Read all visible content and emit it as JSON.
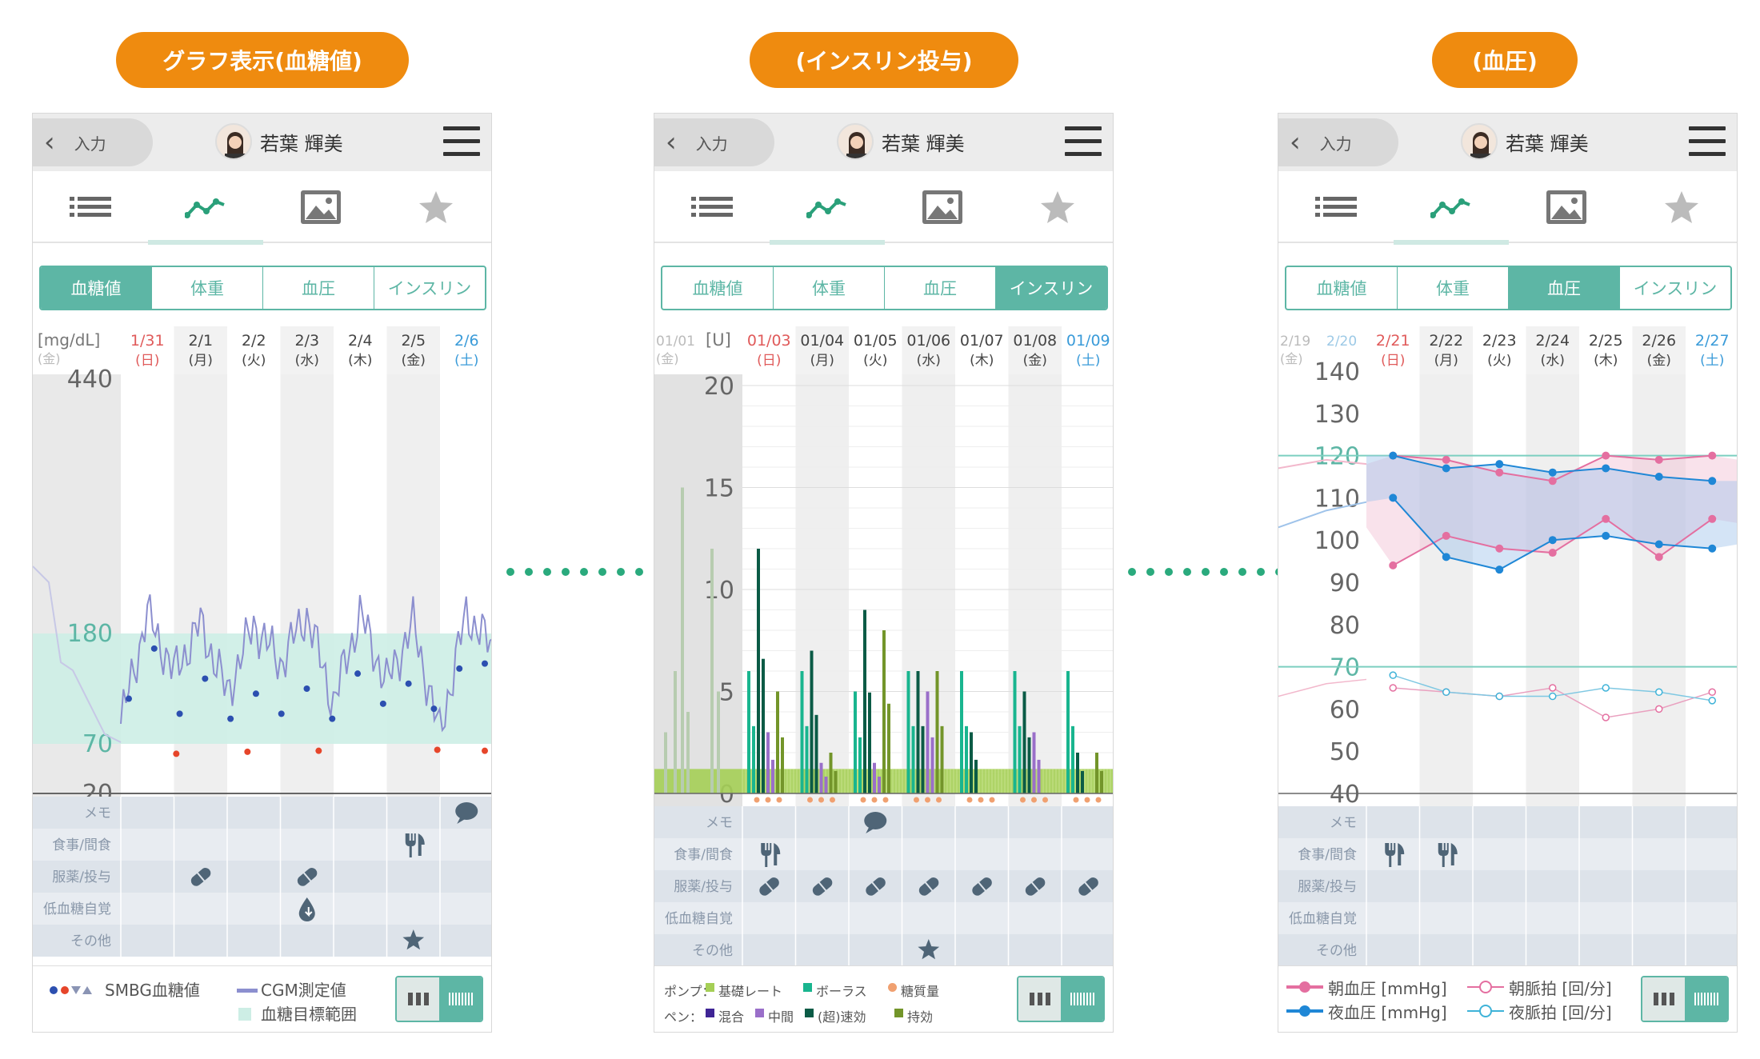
{
  "headers": [
    "グラフ表示(血糖値)",
    "(インスリン投与)",
    "(血圧)"
  ],
  "common": {
    "back_label": "入力",
    "user_name": "若葉 輝美",
    "segments": [
      "血糖値",
      "体重",
      "血圧",
      "インスリン"
    ],
    "row_labels": [
      "メモ",
      "食事/間食",
      "服薬/投与",
      "低血糖自覚",
      "その他"
    ]
  },
  "colors": {
    "accent": "#5db6a5",
    "header_pill": "#ef8b0f",
    "sunday": "#e05a5a",
    "saturday": "#3a9bd9",
    "target_band": "#cdeee5"
  },
  "glucose": {
    "active_segment": "血糖値",
    "unit": "[mg/dL]",
    "prev_day": {
      "date": "",
      "dow": "(金)"
    },
    "days": [
      {
        "date": "1/31",
        "dow": "(日)"
      },
      {
        "date": "2/1",
        "dow": "(月)"
      },
      {
        "date": "2/2",
        "dow": "(火)"
      },
      {
        "date": "2/3",
        "dow": "(水)"
      },
      {
        "date": "2/4",
        "dow": "(木)"
      },
      {
        "date": "2/5",
        "dow": "(金)"
      },
      {
        "date": "2/6",
        "dow": "(土)"
      }
    ],
    "y_ticks": [
      "440",
      "180",
      "70",
      "20"
    ],
    "target_range": [
      70,
      180
    ],
    "legend": {
      "smbg": "SMBG血糖値",
      "cgm": "CGM測定値",
      "target": "血糖目標範囲"
    }
  },
  "insulin": {
    "active_segment": "インスリン",
    "unit": "[U]",
    "prev_day": {
      "date": "01/01",
      "dow": "(金)"
    },
    "days": [
      {
        "date": "01/03",
        "dow": "(日)"
      },
      {
        "date": "01/04",
        "dow": "(月)"
      },
      {
        "date": "01/05",
        "dow": "(火)"
      },
      {
        "date": "01/06",
        "dow": "(水)"
      },
      {
        "date": "01/07",
        "dow": "(木)"
      },
      {
        "date": "01/08",
        "dow": "(金)"
      },
      {
        "date": "01/09",
        "dow": "(土)"
      }
    ],
    "y_ticks": [
      "20",
      "15",
      "10",
      "5",
      "0"
    ],
    "legend": {
      "pump_label": "ポンプ：",
      "basal": "基礎レート",
      "bolus": "ボーラス",
      "carbs": "糖質量",
      "pen_label": "ペン：",
      "mixed": "混合",
      "intermediate": "中間",
      "rapid": "(超)速効",
      "long": "持効"
    }
  },
  "bp": {
    "active_segment": "血圧",
    "prev_day": {
      "date": "2/19",
      "dow": "(金)",
      "date2": "2/20"
    },
    "days": [
      {
        "date": "2/21",
        "dow": "(日)"
      },
      {
        "date": "2/22",
        "dow": "(月)"
      },
      {
        "date": "2/23",
        "dow": "(火)"
      },
      {
        "date": "2/24",
        "dow": "(水)"
      },
      {
        "date": "2/25",
        "dow": "(木)"
      },
      {
        "date": "2/26",
        "dow": "(金)"
      },
      {
        "date": "2/27",
        "dow": "(土)"
      }
    ],
    "y_ticks": [
      "140",
      "130",
      "120",
      "110",
      "100",
      "90",
      "80",
      "70",
      "60",
      "50",
      "40"
    ],
    "legend": {
      "morning_bp": "朝血圧 [mmHg]",
      "evening_bp": "夜血圧 [mmHg]",
      "morning_pulse": "朝脈拍 [回/分]",
      "evening_pulse": "夜脈拍 [回/分]"
    }
  },
  "chart_data": [
    {
      "type": "line",
      "title": "",
      "ylabel": "[mg/dL]",
      "categories": [
        "1/31",
        "2/1",
        "2/2",
        "2/3",
        "2/4",
        "2/5",
        "2/6"
      ],
      "target_range": [
        70,
        180
      ],
      "ylim": [
        20,
        440
      ],
      "series": [
        {
          "name": "CGM測定値",
          "values": [
            90,
            200,
            140,
            190,
            120,
            190,
            150,
            200,
            110,
            200,
            130,
            190,
            80,
            200,
            165
          ]
        },
        {
          "name": "SMBG血糖値",
          "values": [
            115,
            165,
            100,
            135,
            95,
            120,
            100,
            125,
            95,
            140,
            110,
            130,
            105,
            145,
            150
          ]
        }
      ]
    },
    {
      "type": "bar",
      "title": "",
      "ylabel": "[U]",
      "categories": [
        "01/03",
        "01/04",
        "01/05",
        "01/06",
        "01/07",
        "01/08",
        "01/09"
      ],
      "ylim": [
        0,
        20
      ],
      "series": [
        {
          "name": "基礎レート",
          "values": [
            1.2,
            1.2,
            1.2,
            1.2,
            1.2,
            1.2,
            1.2
          ]
        },
        {
          "name": "ボーラス",
          "values": [
            6,
            6,
            5,
            6,
            6,
            6,
            6
          ]
        },
        {
          "name": "(超)速効",
          "values": [
            12,
            7,
            9,
            6,
            3,
            5,
            2
          ]
        },
        {
          "name": "中間",
          "values": [
            3,
            1.5,
            1.5,
            5,
            0,
            3,
            0
          ]
        },
        {
          "name": "持効",
          "values": [
            5,
            2,
            8,
            6,
            0,
            0,
            2
          ]
        }
      ]
    },
    {
      "type": "line",
      "title": "",
      "ylabel": "",
      "categories": [
        "2/21",
        "2/22",
        "2/23",
        "2/24",
        "2/25",
        "2/26",
        "2/27"
      ],
      "ylim": [
        40,
        140
      ],
      "reference_lines": [
        120,
        70
      ],
      "series": [
        {
          "name": "朝血圧 [mmHg]",
          "values": [
            [
              120,
              94
            ],
            [
              119,
              101
            ],
            [
              116,
              98
            ],
            [
              114,
              97
            ],
            [
              120,
              105
            ],
            [
              119,
              96
            ],
            [
              120,
              105
            ]
          ]
        },
        {
          "name": "夜血圧 [mmHg]",
          "values": [
            [
              120,
              110
            ],
            [
              117,
              96
            ],
            [
              118,
              93
            ],
            [
              116,
              100
            ],
            [
              117,
              101
            ],
            [
              115,
              99
            ],
            [
              114,
              98
            ]
          ]
        },
        {
          "name": "朝脈拍 [回/分]",
          "values": [
            65,
            64,
            63,
            65,
            58,
            60,
            64
          ]
        },
        {
          "name": "夜脈拍 [回/分]",
          "values": [
            68,
            64,
            63,
            63,
            65,
            64,
            62
          ]
        }
      ]
    }
  ]
}
